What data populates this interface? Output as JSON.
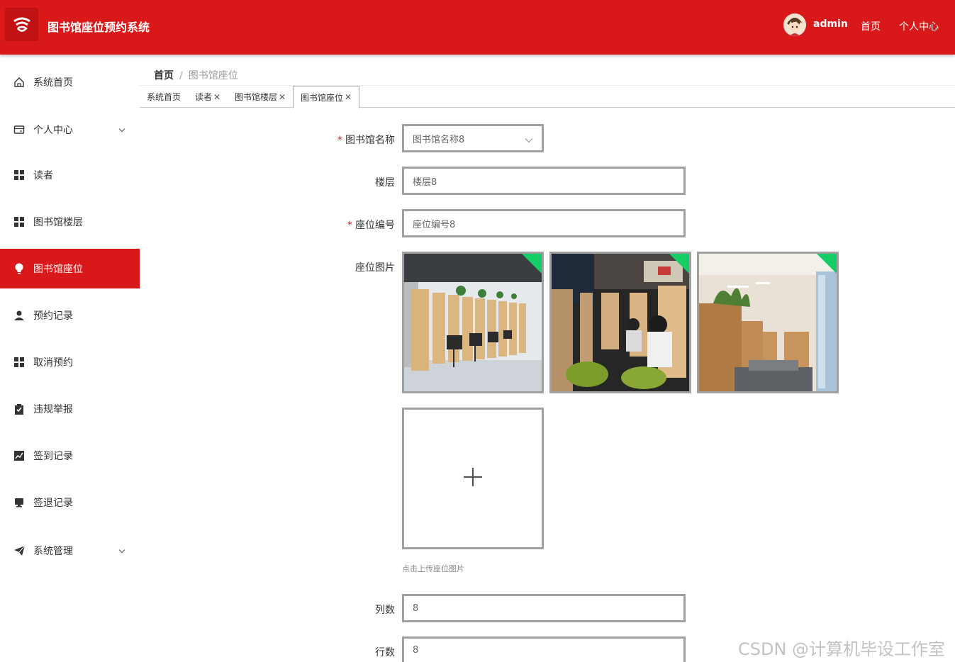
{
  "header": {
    "title": "图书馆座位预约系统",
    "logo_icon": "logo-icon",
    "user": "admin",
    "links": [
      "首页",
      "个人中心"
    ],
    "color": "#d91919"
  },
  "sidebar": {
    "items": [
      {
        "label": "系统首页",
        "icon": "home-icon"
      },
      {
        "label": "个人中心",
        "icon": "wallet-icon",
        "expandable": true
      },
      {
        "label": "读者",
        "icon": "grid-icon"
      },
      {
        "label": "图书馆楼层",
        "icon": "grid-icon"
      },
      {
        "label": "图书馆座位",
        "icon": "bulb-icon",
        "active": true
      },
      {
        "label": "预约记录",
        "icon": "user-icon"
      },
      {
        "label": "取消预约",
        "icon": "grid-icon"
      },
      {
        "label": "违规举报",
        "icon": "clipboard-icon"
      },
      {
        "label": "签到记录",
        "icon": "chart-icon"
      },
      {
        "label": "签退记录",
        "icon": "monitor-icon"
      },
      {
        "label": "系统管理",
        "icon": "send-icon",
        "expandable": true
      }
    ]
  },
  "breadcrumb": {
    "home": "首页",
    "sep": "/",
    "current": "图书馆座位"
  },
  "tabs": [
    {
      "label": "系统首页",
      "closable": false
    },
    {
      "label": "读者",
      "closable": true
    },
    {
      "label": "图书馆楼层",
      "closable": true
    },
    {
      "label": "图书馆座位",
      "closable": true,
      "active": true
    }
  ],
  "form": {
    "library_name": {
      "label": "图书馆名称",
      "value": "图书馆名称8",
      "required": true
    },
    "floor": {
      "label": "楼层",
      "value": "楼层8"
    },
    "seat_no": {
      "label": "座位编号",
      "value": "座位编号8",
      "required": true
    },
    "seat_image": {
      "label": "座位图片",
      "hint": "点击上传座位图片",
      "count": 3
    },
    "columns": {
      "label": "列数",
      "value": "8"
    },
    "rows": {
      "label": "行数",
      "value": "8"
    }
  },
  "watermark": "CSDN @计算机毕设工作室"
}
